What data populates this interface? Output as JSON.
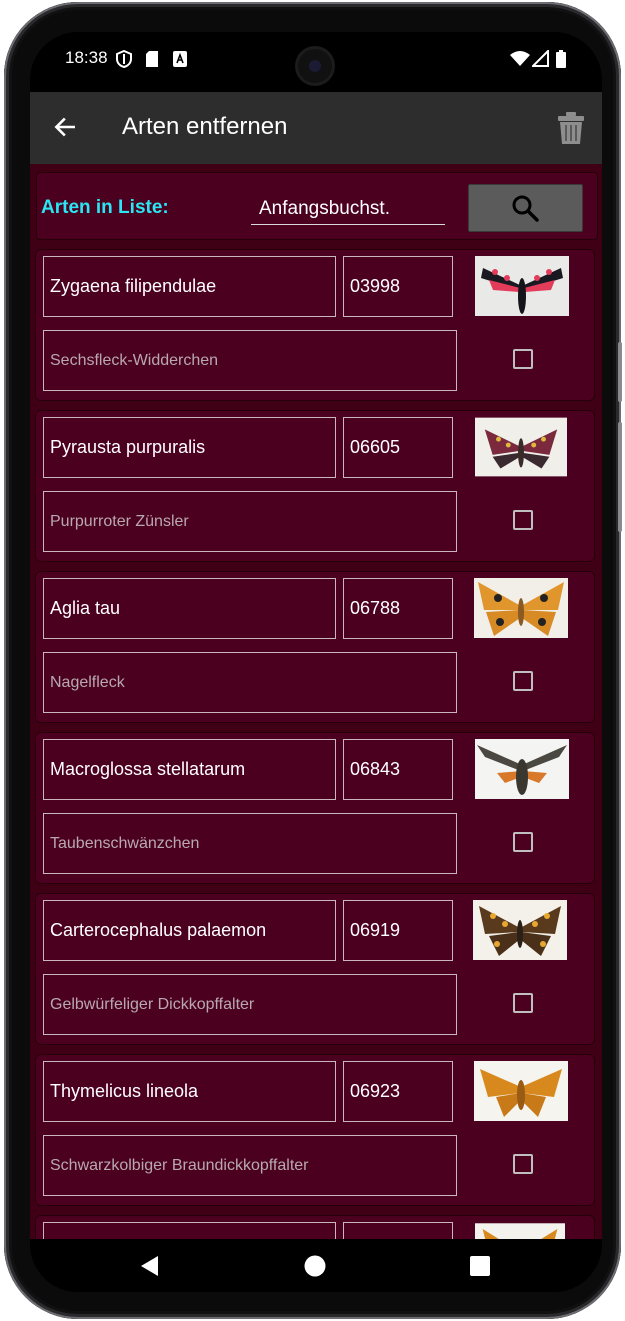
{
  "status_bar": {
    "time": "18:38"
  },
  "appbar": {
    "title": "Arten entfernen"
  },
  "filter": {
    "label": "Arten in Liste:",
    "input_placeholder": "Anfangsbuchst."
  },
  "species": [
    {
      "scientific": "Zygaena filipendulae",
      "number": "03998",
      "common": "Sechsfleck-Widderchen",
      "checked": false,
      "thumbnail": "burnet-moth-red-black"
    },
    {
      "scientific": "Pyrausta purpuralis",
      "number": "06605",
      "common": "Purpurroter Zünsler",
      "checked": false,
      "thumbnail": "purple-moth-yellow-spots"
    },
    {
      "scientific": "Aglia tau",
      "number": "06788",
      "common": "Nagelfleck",
      "checked": false,
      "thumbnail": "orange-moth-eyespots"
    },
    {
      "scientific": "Macroglossa stellatarum",
      "number": "06843",
      "common": "Taubenschwänzchen",
      "checked": false,
      "thumbnail": "hummingbird-hawkmoth"
    },
    {
      "scientific": "Carterocephalus palaemon",
      "number": "06919",
      "common": "Gelbwürfeliger Dickkopffalter",
      "checked": false,
      "thumbnail": "chequered-skipper"
    },
    {
      "scientific": "Thymelicus lineola",
      "number": "06923",
      "common": "Schwarzkolbiger Braundickkopffalter",
      "checked": false,
      "thumbnail": "orange-skipper"
    }
  ],
  "colors": {
    "background": "#3f0016",
    "card": "#4c0020",
    "label_accent": "#29e6f2",
    "appbar": "#2d2d2d"
  }
}
